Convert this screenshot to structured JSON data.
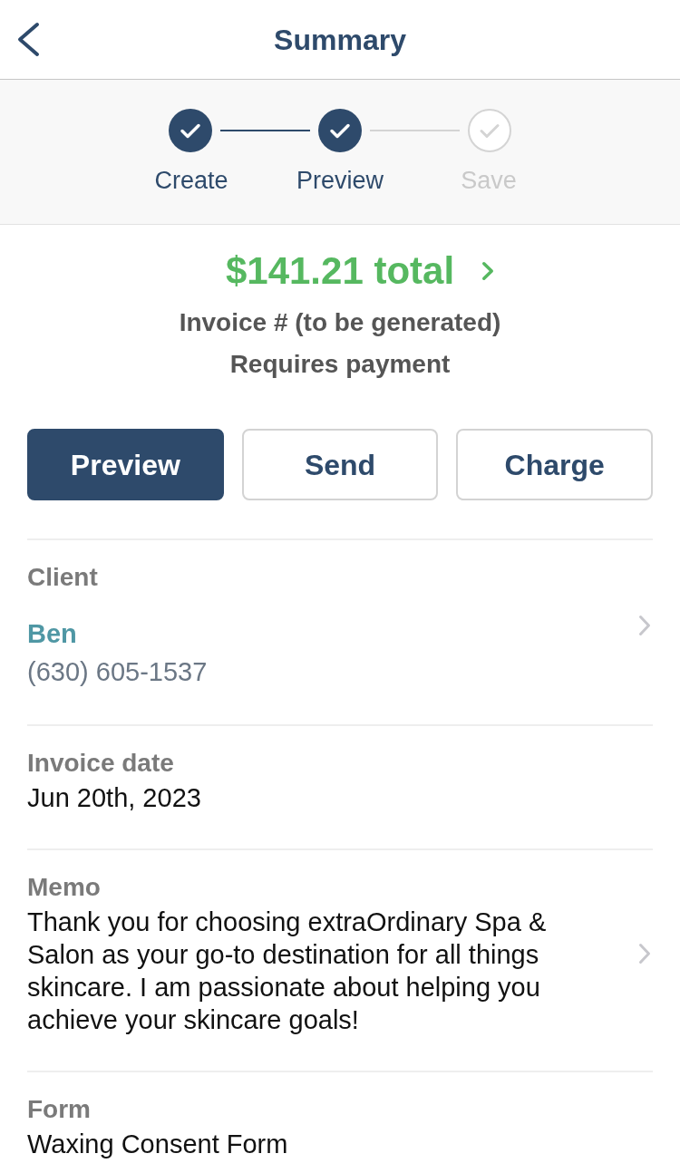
{
  "header": {
    "title": "Summary"
  },
  "steps": [
    {
      "label": "Create",
      "completed": true
    },
    {
      "label": "Preview",
      "completed": true
    },
    {
      "label": "Save",
      "completed": false
    }
  ],
  "summary": {
    "total": "$141.21 total",
    "invoice_number": "Invoice # (to be generated)",
    "status": "Requires payment"
  },
  "actions": [
    {
      "label": "Preview",
      "kind": "primary"
    },
    {
      "label": "Send",
      "kind": "secondary"
    },
    {
      "label": "Charge",
      "kind": "secondary"
    }
  ],
  "sections": [
    {
      "label": "Client",
      "kind": "contact",
      "name": "Ben",
      "phone": "(630) 605-1537",
      "chevron": true
    },
    {
      "label": "Invoice date",
      "kind": "text",
      "value": "Jun 20th, 2023",
      "chevron": false
    },
    {
      "label": "Memo",
      "kind": "text",
      "value": "Thank you for choosing extraOrdinary Spa & Salon as your go-to destination for all things skincare. I am passionate about helping you achieve your skincare goals!",
      "chevron": true
    },
    {
      "label": "Form",
      "kind": "text",
      "value": "Waxing Consent Form",
      "chevron": false
    }
  ]
}
